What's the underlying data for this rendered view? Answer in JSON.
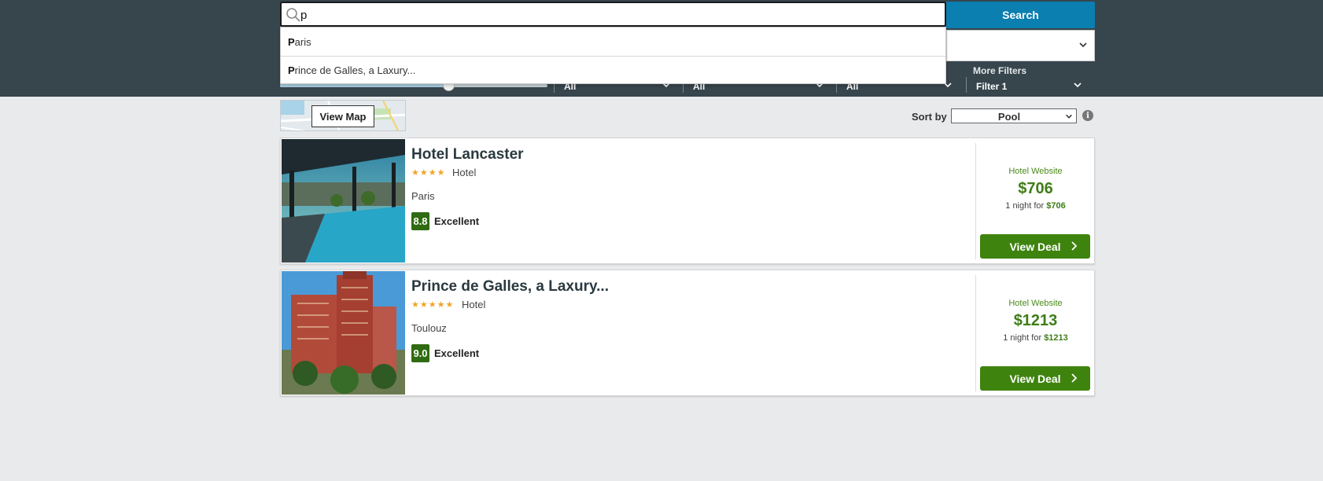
{
  "search": {
    "value": "p",
    "button_label": "Search",
    "suggestions": [
      {
        "match": "P",
        "rest": "aris"
      },
      {
        "match": "P",
        "rest": "rince de Galles, a Laxury..."
      }
    ]
  },
  "filters": {
    "price_slider": 0.63,
    "items": [
      {
        "value": "All"
      },
      {
        "value": "All"
      },
      {
        "value": "All"
      }
    ],
    "more_filters": {
      "label": "More Filters",
      "value": "Filter 1"
    }
  },
  "map": {
    "button_label": "View Map"
  },
  "sort": {
    "label": "Sort by",
    "selected": "Pool",
    "info_icon": "i"
  },
  "hotels": [
    {
      "name": "Hotel Lancaster",
      "stars": "★★★★",
      "type": "Hotel",
      "city": "Paris",
      "score": "8.8",
      "rating": "Excellent",
      "site": "Hotel Website",
      "price": "$706",
      "night_prefix": "1 night for ",
      "night_price": "$706",
      "deal_label": "View Deal"
    },
    {
      "name": "Prince de Galles, a Laxury...",
      "stars": "★★★★★",
      "type": "Hotel",
      "city": "Toulouz",
      "score": "9.0",
      "rating": "Excellent",
      "site": "Hotel Website",
      "price": "$1213",
      "night_prefix": "1 night for ",
      "night_price": "$1213",
      "deal_label": "View Deal"
    }
  ],
  "colors": {
    "header": "#37454d",
    "search_button": "#0a7fb0",
    "deal_button": "#3f830f",
    "price": "#3f7d17",
    "score_badge": "#2f6b12",
    "stars": "#f0a42a"
  }
}
